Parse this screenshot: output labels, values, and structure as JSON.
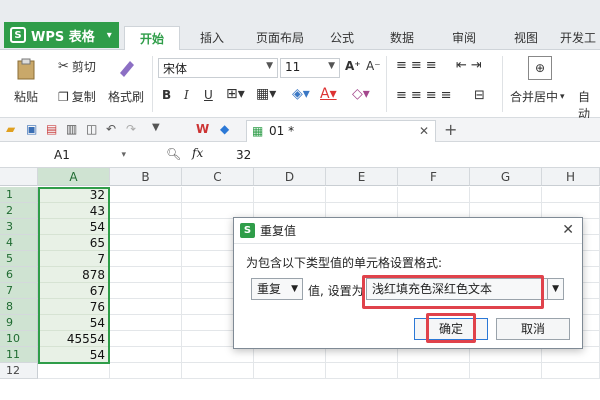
{
  "app": {
    "menu_label": "WPS 表格",
    "logo": "S"
  },
  "tabs": [
    "开始",
    "插入",
    "页面布局",
    "公式",
    "数据",
    "审阅",
    "视图",
    "开发工"
  ],
  "active_tab": "开始",
  "ribbon": {
    "paste": "粘贴",
    "cut": "剪切",
    "copy": "复制",
    "format_painter": "格式刷",
    "font_name": "宋体",
    "font_size": "11",
    "bold": "B",
    "italic": "I",
    "underline": "U",
    "merge_center": "合并居中",
    "auto_wrap": "自动"
  },
  "document_tab": {
    "name": "01 *"
  },
  "formula_bar": {
    "cell_ref": "A1",
    "fx": "fx",
    "value": "32"
  },
  "columns": [
    "A",
    "B",
    "C",
    "D",
    "E",
    "F",
    "G",
    "H"
  ],
  "rows": [
    "1",
    "2",
    "3",
    "4",
    "5",
    "6",
    "7",
    "8",
    "9",
    "10",
    "11",
    "12"
  ],
  "colA_values": [
    "32",
    "43",
    "54",
    "65",
    "7",
    "878",
    "67",
    "76",
    "54",
    "45554",
    "54"
  ],
  "dialog": {
    "title": "重复值",
    "description": "为包含以下类型值的单元格设置格式:",
    "type_value": "重复",
    "mid_label": "值, 设置为",
    "format_value": "浅红填充色深红色文本",
    "ok": "确定",
    "cancel": "取消"
  },
  "colors": {
    "accent": "#2f9d49",
    "highlight": "#e0424b",
    "selection_fill": "#e8f1e6"
  }
}
